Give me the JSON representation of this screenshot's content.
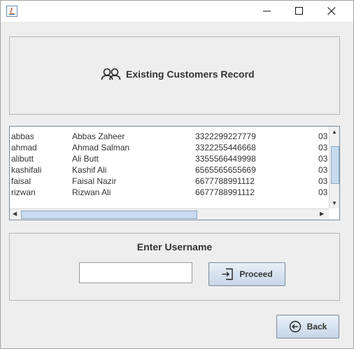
{
  "window": {
    "controls": {
      "minimize": "minimize",
      "maximize": "maximize",
      "close": "close"
    }
  },
  "header": {
    "title": "Existing Customers Record",
    "icon": "users-icon"
  },
  "table": {
    "rows": [
      [
        "abbas",
        "Abbas Zaheer",
        "3322299227779",
        "03"
      ],
      [
        "ahmad",
        "Ahmad Salman",
        "3322255446668",
        "03"
      ],
      [
        "alibutt",
        "Ali Butt",
        "3355566449998",
        "03"
      ],
      [
        "kashifali",
        "Kashif Ali",
        "6565565655669",
        "03"
      ],
      [
        "faisal",
        "Faisal Nazir",
        "6677788991112",
        "03"
      ],
      [
        "rizwan",
        "Rizwan Ali",
        "6677788991112",
        "03"
      ]
    ]
  },
  "form": {
    "label": "Enter Username",
    "username_value": "",
    "proceed_label": "Proceed"
  },
  "footer": {
    "back_label": "Back"
  }
}
